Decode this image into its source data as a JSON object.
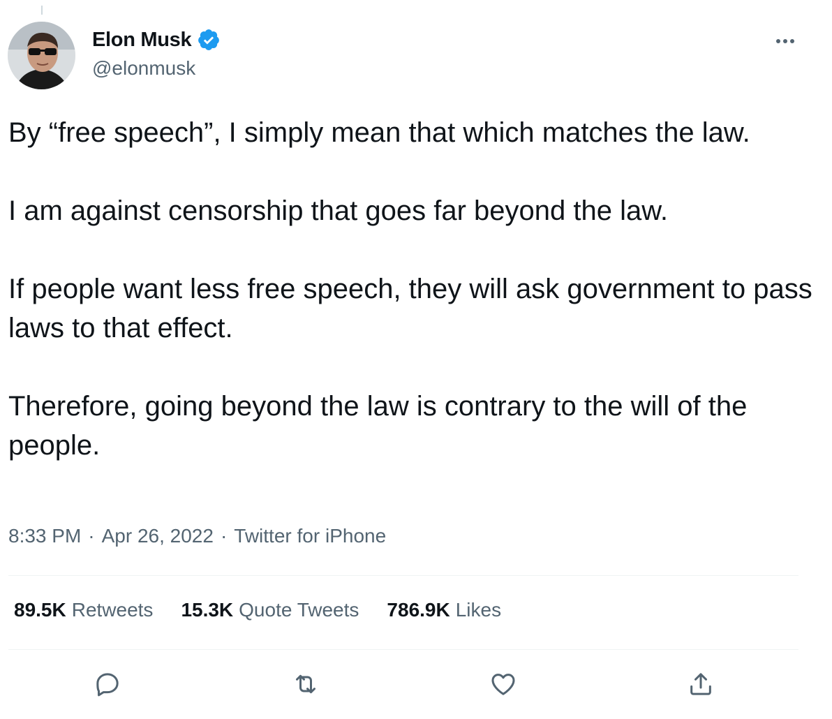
{
  "author": {
    "name": "Elon Musk",
    "handle": "@elonmusk",
    "verified": true
  },
  "tweet": {
    "text": "By “free speech”, I simply mean that which matches the law.\n\nI am against censorship that goes far beyond the law.\n\nIf people want less free speech, they will ask government to pass laws to that effect.\n\nTherefore, going beyond the law is contrary to the will of the people.",
    "time": "8:33 PM",
    "date": "Apr 26, 2022",
    "source": "Twitter for iPhone"
  },
  "stats": {
    "retweets_count": "89.5K",
    "retweets_label": "Retweets",
    "quotes_count": "15.3K",
    "quotes_label": "Quote Tweets",
    "likes_count": "786.9K",
    "likes_label": "Likes"
  },
  "icons": {
    "reply": "reply-icon",
    "retweet": "retweet-icon",
    "like": "heart-icon",
    "share": "share-icon",
    "more": "more-icon",
    "verified": "verified-badge-icon"
  },
  "colors": {
    "verified_blue": "#1d9bf0",
    "secondary_text": "#536471",
    "primary_text": "#0f1419"
  }
}
